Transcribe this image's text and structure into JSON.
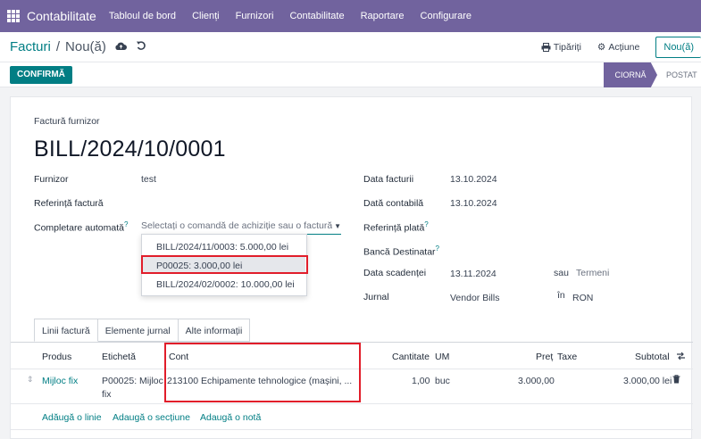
{
  "navbar": {
    "app_name": "Contabilitate",
    "items": [
      "Tabloul de bord",
      "Clienți",
      "Furnizori",
      "Contabilitate",
      "Raportare",
      "Configurare"
    ]
  },
  "breadcrumb": {
    "parent": "Facturi",
    "current": "Nou(ă)"
  },
  "control": {
    "print": "Tipăriți",
    "action": "Acțiune",
    "new": "Nou(ă)"
  },
  "status": {
    "confirm": "CONFIRMĂ",
    "stages": [
      "CIORNĂ",
      "POSTAT"
    ],
    "active_stage": "CIORNĂ"
  },
  "form": {
    "type_label": "Factură furnizor",
    "name": "BILL/2024/10/0001",
    "left": {
      "vendor_label": "Furnizor",
      "vendor_value": "test",
      "ref_label": "Referință factură",
      "autocomplete_label": "Completare automată",
      "autocomplete_placeholder": "Selectați o comandă de achiziție sau o factură v"
    },
    "right": {
      "invoice_date_label": "Data facturii",
      "invoice_date": "13.10.2024",
      "accounting_date_label": "Dată contabilă",
      "accounting_date": "13.10.2024",
      "payment_ref_label": "Referință plată",
      "bank_label": "Bancă Destinatar",
      "due_date_label": "Data scadenței",
      "due_date": "13.11.2024",
      "or_label": "sau",
      "terms_placeholder": "Termeni",
      "journal_label": "Jurnal",
      "journal": "Vendor Bills",
      "in_label": "în",
      "currency": "RON"
    }
  },
  "dropdown": {
    "items": [
      "BILL/2024/11/0003: 5.000,00 lei",
      "P00025: 3.000,00 lei",
      "BILL/2024/02/0002: 10.000,00 lei"
    ],
    "highlighted_index": 1
  },
  "tabs": [
    "Linii factură",
    "Elemente jurnal",
    "Alte informații"
  ],
  "table": {
    "headers": {
      "product": "Produs",
      "label": "Etichetă",
      "account": "Cont",
      "qty": "Cantitate",
      "uom": "UM",
      "price": "Preț",
      "taxes": "Taxe",
      "subtotal": "Subtotal"
    },
    "rows": [
      {
        "product": "Mijloc fix",
        "label_l1": "P00025: Mijloc",
        "label_l2": "fix",
        "account": "213100 Echipamente tehnologice (mașini, ...",
        "qty": "1,00",
        "uom": "buc",
        "price": "3.000,00",
        "taxes": "",
        "subtotal": "3.000,00 lei"
      }
    ],
    "add_links": [
      "Adăugă o linie",
      "Adaugă o secțiune",
      "Adaugă o notă"
    ]
  },
  "colors": {
    "brand": "#71639e",
    "accent": "#017e84",
    "highlight": "#e11d2a"
  }
}
